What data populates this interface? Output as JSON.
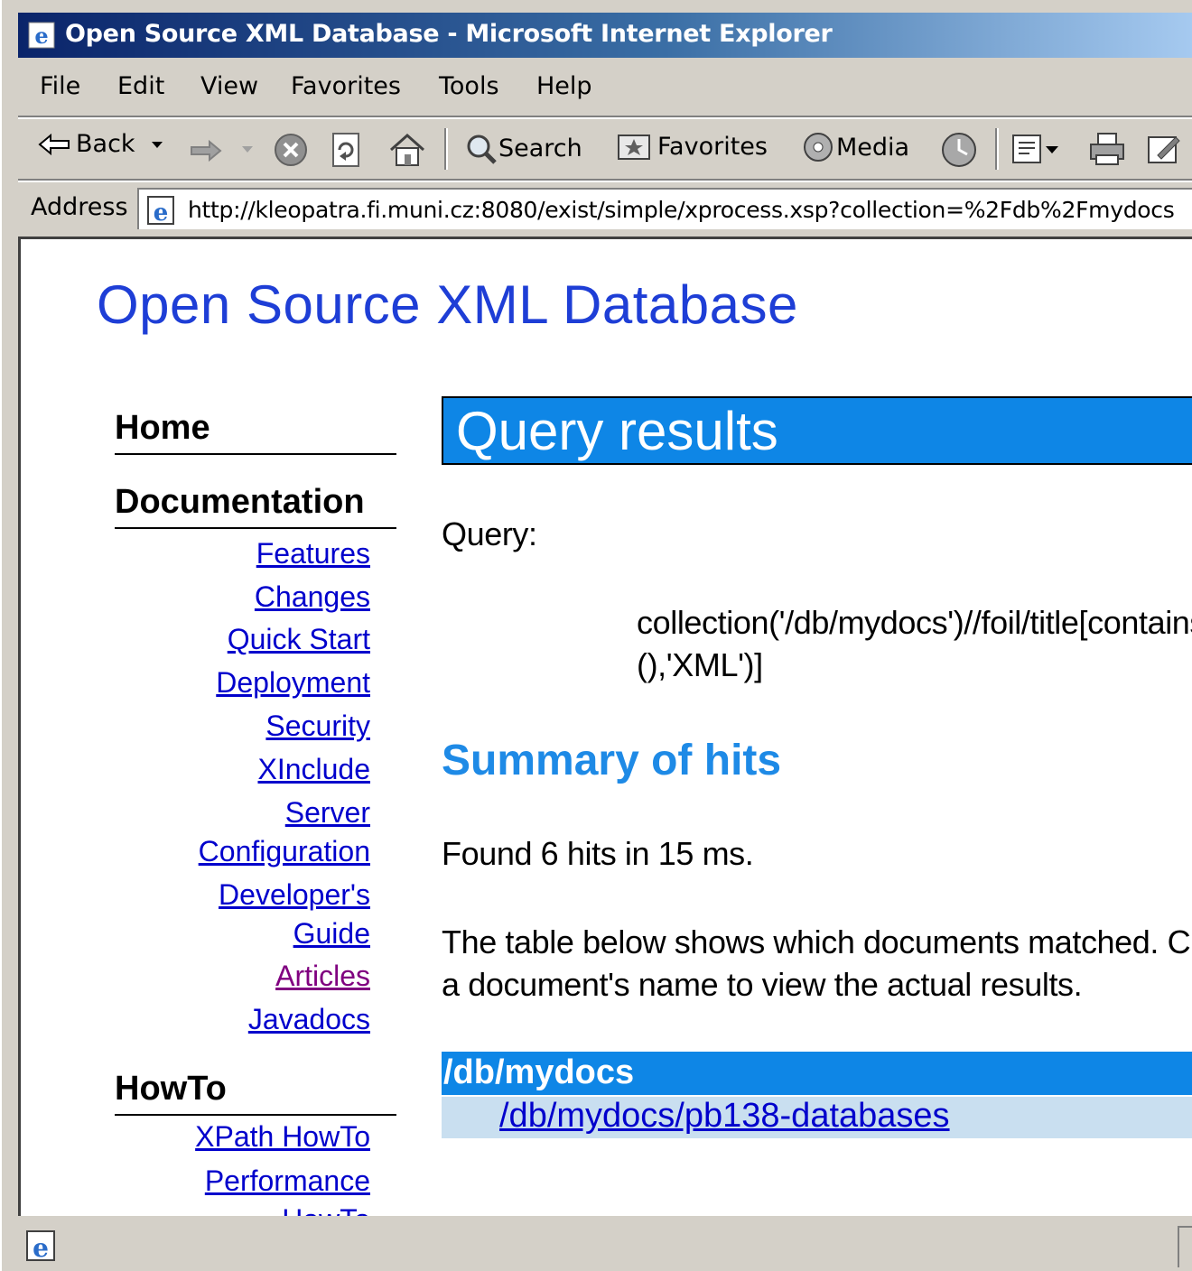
{
  "window": {
    "title": "Open Source XML Database - Microsoft Internet Explorer"
  },
  "menu": [
    "File",
    "Edit",
    "View",
    "Favorites",
    "Tools",
    "Help"
  ],
  "toolbar": {
    "back": "Back",
    "search": "Search",
    "favorites": "Favorites",
    "media": "Media"
  },
  "address": {
    "label": "Address",
    "url": "http://kleopatra.fi.muni.cz:8080/exist/simple/xprocess.xsp?collection=%2Fdb%2Fmydocs"
  },
  "page": {
    "site_title": "Open Source XML Database",
    "nav": {
      "home": "Home",
      "documentation": "Documentation",
      "doc_links": [
        "Features",
        "Changes",
        "Quick Start",
        "Deployment",
        "Security",
        "XInclude",
        "Server",
        "Configuration",
        "Developer's",
        "Guide",
        "Articles",
        "Javadocs"
      ],
      "howto": "HowTo",
      "howto_links": [
        "XPath HowTo",
        "Performance",
        "HowTo"
      ]
    },
    "heading": "Query results",
    "query_label": "Query:",
    "query_line1": "collection('/db/mydocs')//foil/title[contains(text",
    "query_line2": "(),'XML')]",
    "summary_heading": "Summary of hits",
    "found_text": "Found 6 hits in 15 ms.",
    "desc_line1": "The table below shows which documents matched. Click on",
    "desc_line2": "a document's name to view the actual results.",
    "table": {
      "collection": "/db/mydocs",
      "document": "/db/mydocs/pb138-databases"
    }
  },
  "colors": {
    "accent": "#0e86e6",
    "link": "#0000cc",
    "visited": "#800080",
    "site_title": "#1e3ed6"
  }
}
